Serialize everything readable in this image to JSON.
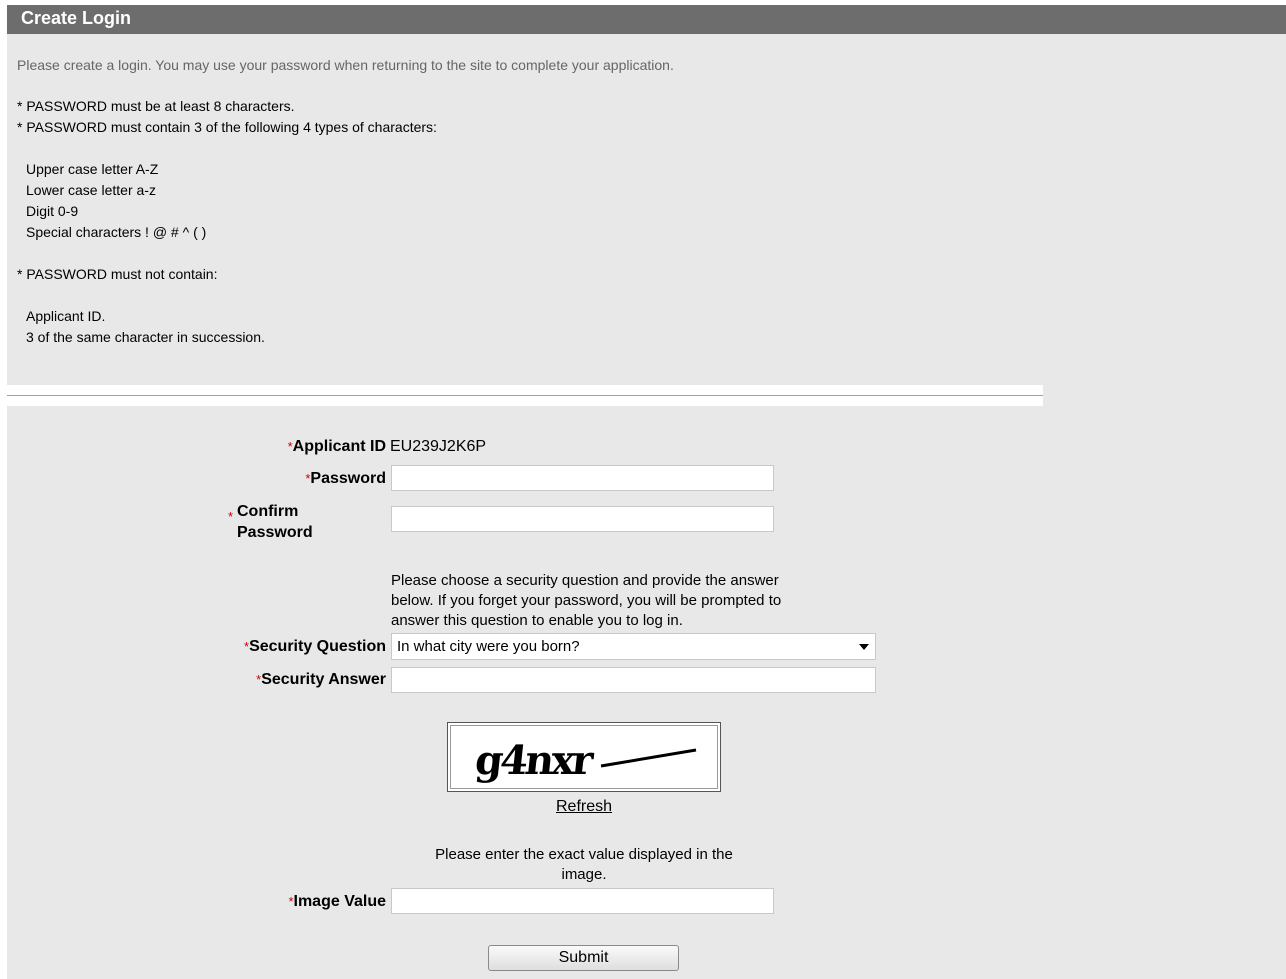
{
  "header": {
    "title": "Create Login"
  },
  "intro": "Please create a login. You may use your password when returning to the site to complete your application.",
  "rules": {
    "min_length": "* PASSWORD must be at least 8 characters.",
    "contain_types": "* PASSWORD must contain 3 of the following 4 types of characters:",
    "types": [
      "Upper case letter A-Z",
      "Lower case letter a-z",
      "Digit 0-9",
      "Special characters ! @ # ^ ( )"
    ],
    "must_not": "* PASSWORD must not contain:",
    "not_items": [
      "Applicant ID.",
      "3 of the same character in succession."
    ]
  },
  "form": {
    "required_marker": "*",
    "applicant_id_label": "Applicant ID",
    "applicant_id_value": "EU239J2K6P",
    "password_label": "Password",
    "password_value": "",
    "confirm_label_line1": "Confirm",
    "confirm_label_line2": "Password",
    "confirm_value": "",
    "security_note_line1": "Please choose a security question and provide the answer",
    "security_note_line2": "below. If you forget your password, you will be prompted to",
    "security_note_line3": "answer this question to enable you to log in.",
    "security_question_label": "Security Question",
    "security_question_value": "In what city were you born?",
    "security_answer_label": "Security Answer",
    "security_answer_value": "",
    "captcha_text": "g4nxr",
    "refresh_label": "Refresh",
    "image_note_line1": "Please enter the exact value displayed in the",
    "image_note_line2": "image.",
    "image_value_label": "Image Value",
    "image_value": "",
    "submit_label": "Submit"
  },
  "colors": {
    "header_bg": "#6d6d6d",
    "page_bg": "#e8e8e8",
    "required": "#cc0000"
  }
}
